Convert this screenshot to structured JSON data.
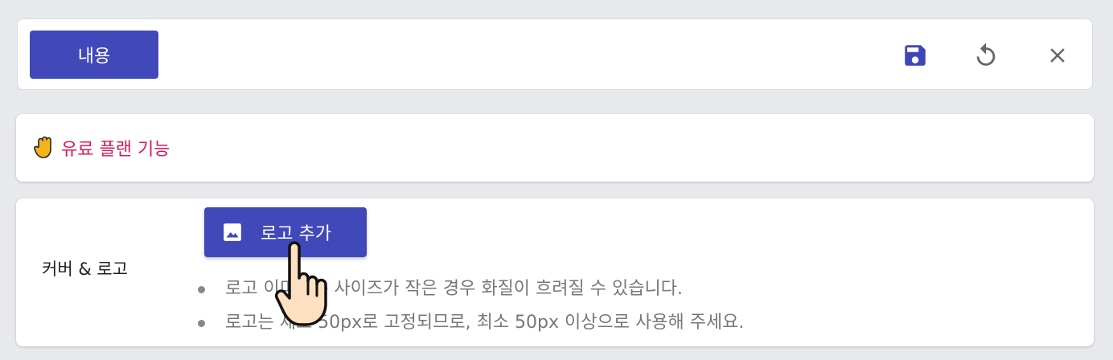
{
  "toolbar": {
    "tab_label": "내용",
    "save_icon": "save-icon",
    "reset_icon": "reset-icon",
    "close_icon": "close-icon",
    "accent": "#4148b9"
  },
  "notice": {
    "icon": "hand-icon",
    "text": "유료 플랜 기능",
    "color": "#d6195f"
  },
  "logo_section": {
    "label": "커버 & 로고",
    "add_button_label": "로고 추가",
    "add_button_icon": "image-icon",
    "hints": [
      "로고 이미지는 사이즈가 작은 경우 화질이 흐려질 수 있습니다.",
      "로고는 세로 50px로 고정되므로, 최소 50px 이상으로 사용해 주세요."
    ]
  },
  "cursor": {
    "icon": "pointer-hand-cursor-icon"
  }
}
